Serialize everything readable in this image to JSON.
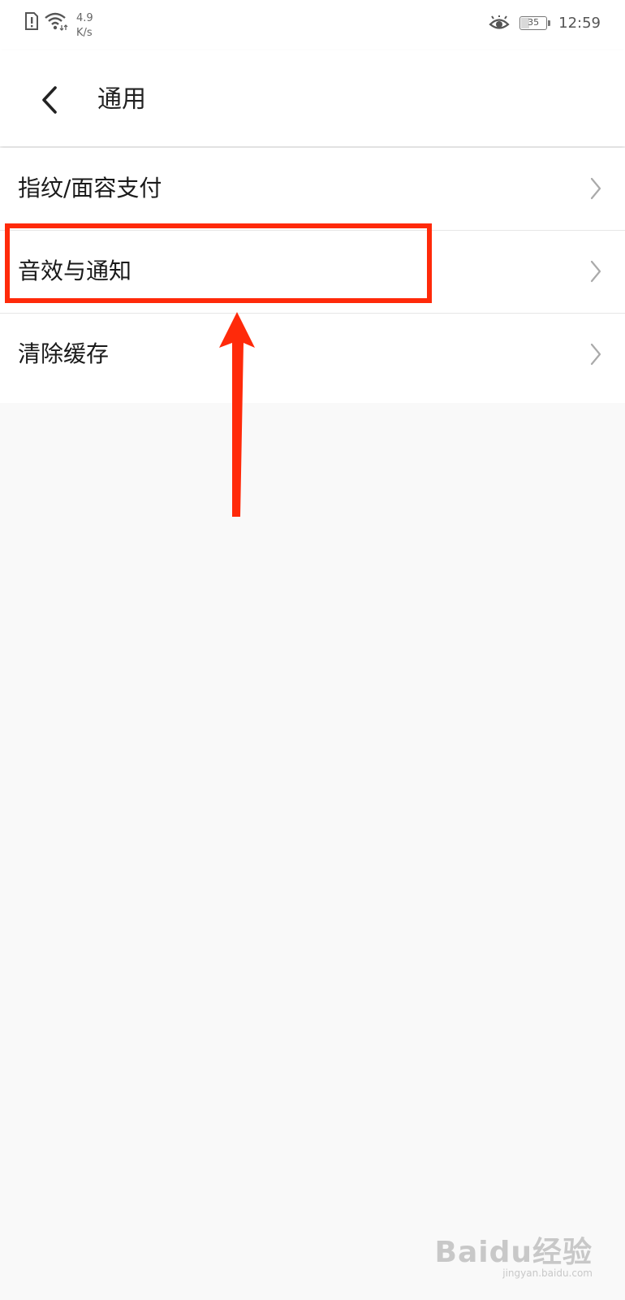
{
  "status_bar": {
    "speed_value": "4.9",
    "speed_unit": "K/s",
    "battery_level": "35",
    "time": "12:59"
  },
  "header": {
    "back_icon": "chevron-left-icon",
    "title": "通用"
  },
  "settings": [
    {
      "label": "指纹/面容支付",
      "icon": "chevron-right-icon"
    },
    {
      "label": "音效与通知",
      "icon": "chevron-right-icon"
    },
    {
      "label": "清除缓存",
      "icon": "chevron-right-icon"
    }
  ],
  "annotation": {
    "color": "#ff2a0a"
  },
  "watermark": {
    "main": "Baidu经验",
    "sub": "jingyan.baidu.com"
  }
}
